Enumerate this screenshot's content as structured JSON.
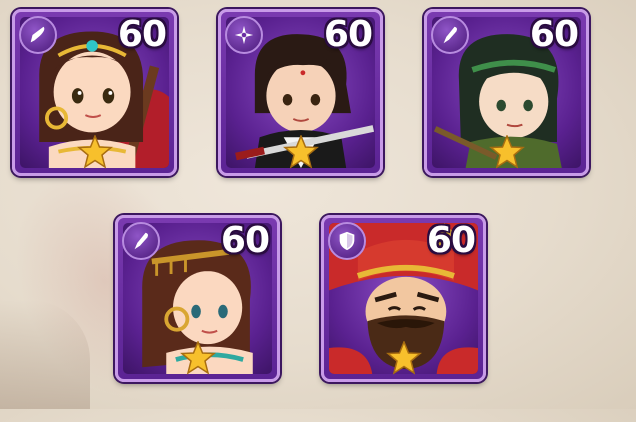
{
  "heroes": [
    {
      "level": "60",
      "class_icon": "blade-icon",
      "stars": 1,
      "portrait": "female-musician-hero"
    },
    {
      "level": "60",
      "class_icon": "shuriken-icon",
      "stars": 1,
      "portrait": "swordsman-hero"
    },
    {
      "level": "60",
      "class_icon": "blade-icon",
      "stars": 1,
      "portrait": "green-headband-hero"
    },
    {
      "level": "60",
      "class_icon": "blade-icon",
      "stars": 1,
      "portrait": "female-dancer-hero"
    },
    {
      "level": "60",
      "class_icon": "shield-icon",
      "stars": 1,
      "portrait": "bearded-general-hero"
    }
  ],
  "colors": {
    "card_bg": "#6b2ea3",
    "card_border": "#c89be8",
    "star": "#f7c02c"
  }
}
